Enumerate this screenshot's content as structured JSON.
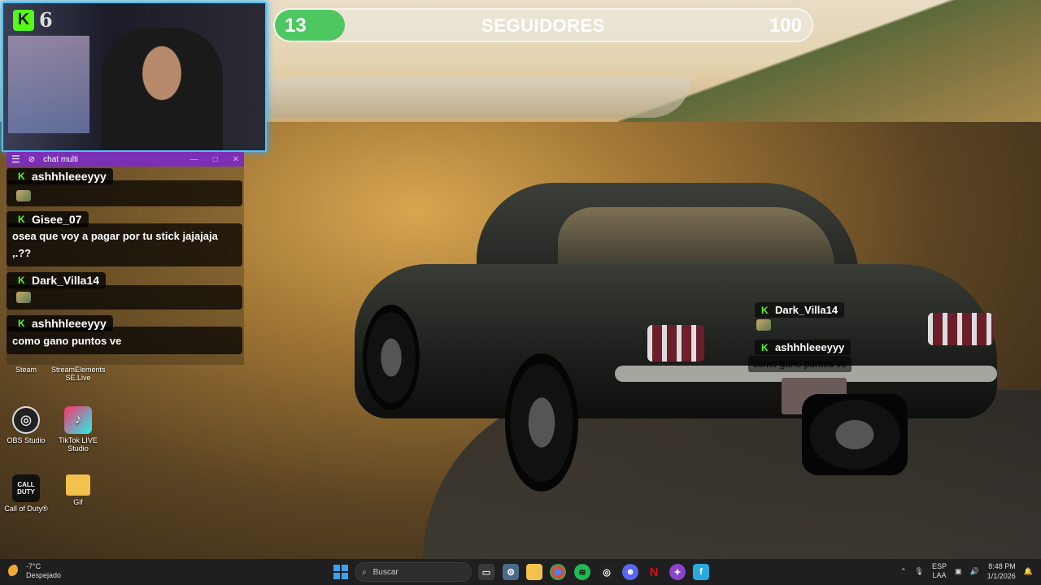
{
  "webcam": {
    "count": "6"
  },
  "goal": {
    "current": "13",
    "title": "SEGUIDORES",
    "max": "100",
    "progress": 0.13,
    "color": "#4ec760"
  },
  "chat_window": {
    "title": "chat multi",
    "messages": [
      {
        "user": "ashhhleeeyyy",
        "text": ""
      },
      {
        "user": "Gisee_07",
        "text": "osea que voy a pagar por tu stick jajajaja ,.??"
      },
      {
        "user": "Dark_Villa14",
        "text": ""
      },
      {
        "user": "ashhhleeeyyy",
        "text": "como gano puntos ve"
      }
    ]
  },
  "desktop_icons": [
    {
      "label": "Steam",
      "icon": "steam-icon"
    },
    {
      "label": "StreamElements SE.Live",
      "icon": "streamelements-icon"
    },
    {
      "label": "OBS Studio",
      "icon": "obs-icon"
    },
    {
      "label": "TikTok LIVE Studio",
      "icon": "tiktok-icon"
    },
    {
      "label": "Call of Duty®",
      "icon": "callofduty-icon",
      "glyph": "CALL\nDUTY"
    },
    {
      "label": "Gif",
      "icon": "folder-icon"
    }
  ],
  "overlay_chat": [
    {
      "user": "Dark_Villa14",
      "text": ""
    },
    {
      "user": "ashhhleeeyyy",
      "text": "como gano puntos ve"
    }
  ],
  "taskbar": {
    "weather_temp": "-7°C",
    "weather_desc": "Despejado",
    "search_placeholder": "Buscar",
    "lang_top": "ESP",
    "lang_bottom": "LAA",
    "time": "8:48 PM",
    "date": "1/1/2026"
  },
  "colors": {
    "kick_green": "#53fc18",
    "chat_titlebar": "#7b2fb5",
    "webcam_border": "#4cc3ff"
  }
}
